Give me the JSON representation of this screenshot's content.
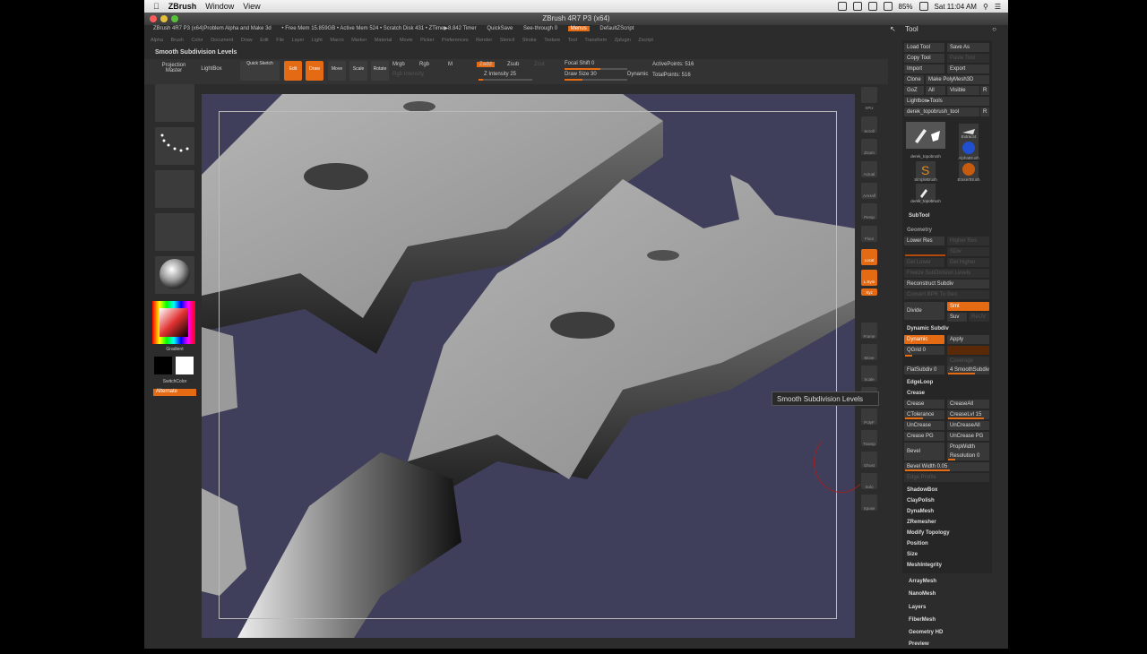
{
  "menubar": {
    "app": "ZBrush",
    "items": [
      "Window",
      "View"
    ],
    "battery": "85%",
    "clock": "Sat 11:04 AM"
  },
  "window": {
    "title": "ZBrush 4R7 P3 (x64)"
  },
  "infobar": {
    "doc": "ZBrush 4R7 P3 (x64)Problem Alpha and Make 3d",
    "free_mem": "• Free Mem 15.859GB • Active Mem 524 • Scratch Disk 431 • ZTime▶8.842 Timer",
    "quicksave": "QuickSave",
    "see_through": "See-through 0",
    "menus": "Menus",
    "script": "DefaultZScript"
  },
  "menus": [
    "Alpha",
    "Brush",
    "Color",
    "Document",
    "Draw",
    "Edit",
    "File",
    "Layer",
    "Light",
    "Macro",
    "Marker",
    "Material",
    "Movie",
    "Picker",
    "Preferences",
    "Render",
    "Stencil",
    "Stroke",
    "Texture",
    "Tool",
    "Transform",
    "Zplugin",
    "Zscript"
  ],
  "toolbar": {
    "subtitle": "Smooth Subdivision Levels",
    "projection": "Projection Master",
    "lightbox": "LightBox",
    "quicksketch": "Quick Sketch",
    "edit": "Edit",
    "draw": "Draw",
    "move": "Move",
    "scale": "Scale",
    "rotate": "Rotate",
    "mrgb": "Mrgb",
    "rgb": "Rgb",
    "m": "M",
    "zadd": "Zadd",
    "zsub": "Zsub",
    "zcut": "Zcut",
    "rgb_intensity": "Rgb Intensity",
    "z_intensity": "Z Intensity 25",
    "focal_shift": "Focal Shift 0",
    "draw_size": "Draw Size 30",
    "dynamic": "Dynamic",
    "active_points": "ActivePoints: 516",
    "total_points": "TotalPoints: 516"
  },
  "left_shelf": {
    "gradient": "Gradient",
    "switchcolor": "SwitchColor",
    "alternate": "Alternate"
  },
  "right_shelf": [
    "SPix",
    "Scroll",
    "Zoom",
    "Actual",
    "AAHalf",
    "Persp",
    "Floor",
    "Local",
    "L.Sym",
    "Xyz",
    "Frame",
    "Move",
    "Scale",
    "Rotate",
    "PolyF",
    "Transp",
    "Ghost",
    "Solo",
    "Xpose"
  ],
  "tooltip": "Smooth Subdivision Levels",
  "tool": {
    "title": "Tool",
    "load": "Load Tool",
    "save_as": "Save As",
    "copy": "Copy Tool",
    "paste": "Paste Tool",
    "import": "Import",
    "export": "Export",
    "clone": "Clone",
    "make_poly": "Make PolyMesh3D",
    "goz": "GoZ",
    "all": "All",
    "visible": "Visible",
    "r": "R",
    "lightbox_tools": "Lightbox▸Tools",
    "current": "derek_topobrush_tool",
    "r2": "R",
    "thumbs": [
      "derek_topobrush",
      "Extract4",
      "AlphaBrush",
      "SimpleBrush",
      "EraserBrush",
      "derek_topobrush"
    ],
    "subtool": "SubTool",
    "geometry": "Geometry",
    "lower_res": "Lower Res",
    "higher_res": "Higher Res",
    "sdiv": "SDiv",
    "del_lower": "Del Lower",
    "del_higher": "Del Higher",
    "freeze": "Freeze SubDivision Levels",
    "reconstruct": "Reconstruct Subdiv",
    "convert_bpr": "Convert BPR To Geo",
    "divide": "Divide",
    "smt": "Smt",
    "suv": "Suv",
    "relax": "ReUV",
    "dynamic_subdiv": "Dynamic Subdiv",
    "dynamic": "Dynamic",
    "apply": "Apply",
    "qgrid": "QGrid 0",
    "coverage": "Coverage",
    "smoothsubdiv": "4 SmoothSubdiv",
    "flatsubdiv": "FlatSubdiv 0",
    "edgeloop": "EdgeLoop",
    "crease": "Crease",
    "crease_btn": "Crease",
    "creaseall": "CreaseAll",
    "ctolerance": "CTolerance",
    "creaselvl": "CreaseLvl 15",
    "uncrease": "UnCrease",
    "uncreaseall": "UnCreaseAll",
    "crease_pg": "Crease PG",
    "uncrease_pg": "UnCrease PG",
    "bevel": "Bevel",
    "propwidth": "PropWidth",
    "resolution": "Resolution 0",
    "bevel_width": "Bevel Width 0.05",
    "edge_profile": "Edge Profile",
    "sections": [
      "ShadowBox",
      "ClayPolish",
      "DynaMesh",
      "ZRemesher",
      "Modify Topology",
      "Position",
      "Size",
      "MeshIntegrity"
    ],
    "bottom": [
      "ArrayMesh",
      "NanoMesh",
      "Layers",
      "FiberMesh",
      "Geometry HD",
      "Preview"
    ]
  }
}
